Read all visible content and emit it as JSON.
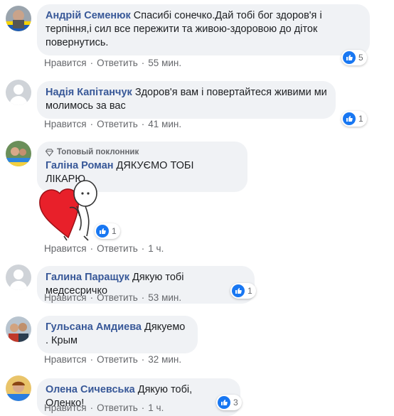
{
  "comments": [
    {
      "author": "Андрій Семенюк",
      "text": "Спасибі сонечко.Дай тобі бог здоров'я і терпіння,і сил все пережити та живою-здоровою до діток повернутись.",
      "reactions": "5",
      "like": "Нравится",
      "reply": "Ответить",
      "time": "55 мин."
    },
    {
      "author": "Надія Капітанчук",
      "text": "Здоров'я вам і повертайтеся живими ми молимось за вас",
      "reactions": "1",
      "like": "Нравится",
      "reply": "Ответить",
      "time": "41 мин."
    },
    {
      "badge": "Топовый поклонник",
      "author": "Галіна Роман",
      "text": "ДЯКУЄМО ТОБІ ЛІКАРЮ.",
      "reactions": "1",
      "like": "Нравится",
      "reply": "Ответить",
      "time": "1 ч."
    },
    {
      "author": "Галина Паращук",
      "text": "Дякую тобі медсесричко",
      "reactions": "1",
      "like": "Нравится",
      "reply": "Ответить",
      "time": "53 мин."
    },
    {
      "author": "Гульсана Амдиева",
      "text": "Дякуемо . Крым",
      "reactions": "",
      "like": "Нравится",
      "reply": "Ответить",
      "time": "32 мин."
    },
    {
      "author": "Олена Сичевська",
      "text": "Дякую тобі, Оленко!",
      "reactions": "3",
      "like": "Нравится",
      "reply": "Ответить",
      "time": "1 ч."
    }
  ],
  "colors": {
    "author": "#385898",
    "bubble": "#f0f2f5",
    "like_blue": "#1877f2",
    "meta": "#65676b"
  },
  "icons": {
    "reaction": "like-icon",
    "badge": "diamond-icon",
    "sticker": "heart-hug-sticker"
  }
}
